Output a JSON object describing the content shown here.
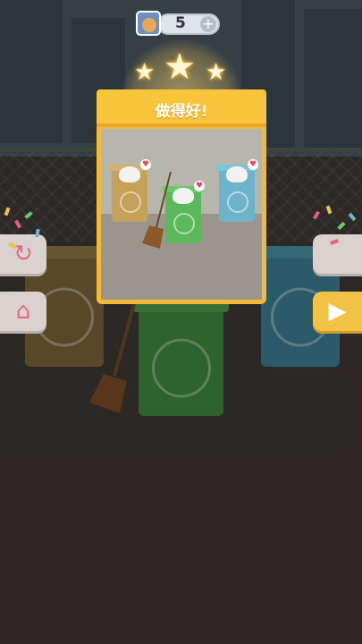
{
  "header": {
    "coin_count": "5",
    "plus_label": "+"
  },
  "dialog": {
    "title": "做得好!",
    "stars_earned": 3,
    "stars_total": 3
  },
  "buttons": {
    "replay_icon": "↻",
    "home_icon": "⌂",
    "next_icon": "▶"
  },
  "colors": {
    "accent_gold": "#f8c53a",
    "bin_brown": "#c5a15a",
    "bin_green": "#5cb85c",
    "bin_blue": "#6db3c9"
  },
  "icons": [
    "coin-avatar-icon",
    "star-icon",
    "heart-icon",
    "replay-icon",
    "home-icon",
    "next-icon",
    "broom-icon",
    "apple-icon",
    "paper-icon",
    "bottle-icon"
  ]
}
